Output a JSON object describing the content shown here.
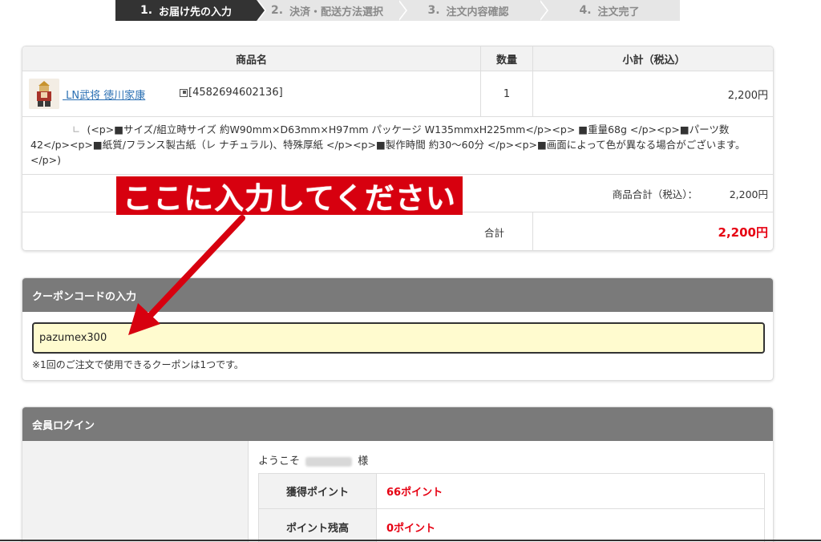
{
  "steps": [
    {
      "num": "1.",
      "label": "お届け先の入力"
    },
    {
      "num": "2.",
      "label": "決済・配送方法選択"
    },
    {
      "num": "3.",
      "label": "注文内容確認"
    },
    {
      "num": "4.",
      "label": "注文完了"
    }
  ],
  "cart": {
    "headers": {
      "name": "商品名",
      "qty": "数量",
      "subtotal": "小計（税込）"
    },
    "product": {
      "name": "LN武将 徳川家康",
      "jan": "[4582694602136]",
      "qty": "1",
      "subtotal": "2,200円",
      "corner": "∟",
      "description": "(<p>■サイズ/組立時サイズ 約W90mm×D63mm×H97mm パッケージ W135mmxH225mm</p><p> ■重量68g </p><p>■パーツ数42</p><p>■紙質/フランス製古紙（レ ナチュラル)、特殊厚紙 </p><p>■製作時間 約30〜60分 </p><p>■画面によって色が異なる場合がございます。 </p>)"
    },
    "item_total_label": "商品合計（税込）：",
    "item_total_value": "2,200円",
    "total_label": "合計",
    "total_value": "2,200円"
  },
  "coupon": {
    "title": "クーポンコードの入力",
    "value": "pazumex300",
    "note": "※1回のご注文で使用できるクーポンは1つです。"
  },
  "member": {
    "title": "会員ログイン",
    "welcome_prefix": "ようこそ",
    "welcome_suffix": "様",
    "rows": [
      {
        "label": "獲得ポイント",
        "value": "66ポイント"
      },
      {
        "label": "ポイント残高",
        "value": "0ポイント"
      }
    ]
  },
  "annotation": {
    "callout": "ここに入力してください"
  },
  "colors": {
    "accent_red": "#e60012",
    "callout_red": "#d7000f",
    "active_step": "#333333",
    "panel_header": "#7a7a7a",
    "input_bg": "#fffbcf",
    "link": "#2a6fb3"
  }
}
